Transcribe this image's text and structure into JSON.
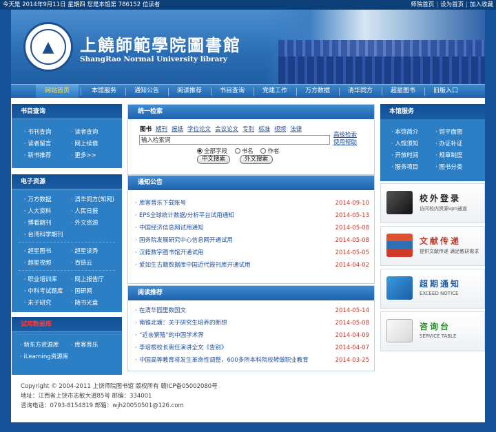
{
  "topbar": {
    "left_text": "今天是 2014年9月11日 星期四 您是本馆第 786152 位读者",
    "links": [
      "师院首页",
      "设为首页",
      "加入收藏"
    ]
  },
  "banner": {
    "title_cn": "上饒師範學院圖書館",
    "title_en": "ShangRao Normal University library"
  },
  "nav": [
    "网站首页",
    "本馆服务",
    "通知公告",
    "阅读推荐",
    "书目查询",
    "党建工作",
    "万方数据",
    "清华同方",
    "超星图书",
    "旧版入口"
  ],
  "left": {
    "catalog": {
      "title": "书目查询",
      "links": [
        "书刊查询",
        "读者查询",
        "读者留言",
        "网上续借",
        "新书推荐",
        "更多>>"
      ]
    },
    "eres": {
      "title": "电子资源",
      "links": [
        "万方数据",
        "清华同方(知网)",
        "人大资料",
        "人民日报",
        "博看期刊",
        "外文资源",
        "台湾科学期刊",
        "超星图书",
        "超星读秀",
        "超星视频",
        "百链云",
        "职业培训库",
        "网上报告厅",
        "中科考试题库",
        "国研网",
        "未子研究",
        "随书光盘"
      ]
    },
    "trial": {
      "title": "试用数据库",
      "links": [
        "新东方资源库",
        "库客音乐",
        "iLearning资源库"
      ]
    }
  },
  "search": {
    "title": "统一检索",
    "categories": [
      "图书",
      "期刊",
      "报纸",
      "学位论文",
      "会议论文",
      "专利",
      "标准",
      "视频",
      "法律"
    ],
    "input_value": "输入检索词",
    "advanced": "高级检索",
    "help": "使用帮助",
    "radios": [
      "全部字段",
      "书名",
      "作者"
    ],
    "btn_cn": "中文搜索",
    "btn_en": "外文搜索"
  },
  "notices": {
    "title": "通知公告",
    "items": [
      {
        "t": "库客音乐下载账号",
        "d": "2014-09-10"
      },
      {
        "t": "EPS全球统计数据/分析平台试用通知",
        "d": "2014-05-13"
      },
      {
        "t": "中国经济信息网试用通知",
        "d": "2014-05-08"
      },
      {
        "t": "国务院发展研究中心信息网开通试用",
        "d": "2014-05-08"
      },
      {
        "t": "汉籍数字图书馆开通试用",
        "d": "2014-05-05"
      },
      {
        "t": "爱如生古籍数据库中国近代报刊库开通试用",
        "d": "2014-04-02"
      }
    ]
  },
  "reading": {
    "title": "阅读推荐",
    "items": [
      {
        "t": "在清华园里数国文",
        "d": "2014-05-14"
      },
      {
        "t": "南锥北塘：关于研究生培养的断想",
        "d": "2014-05-08"
      },
      {
        "t": "“近亲繁殖”的中国学术界",
        "d": "2014-04-09"
      },
      {
        "t": "李培根校长离任演讲全文《告别》",
        "d": "2014-04-07"
      },
      {
        "t": "中国高等教育将发生革命性调整，600多所本科院校转做职业教育",
        "d": "2014-03-25"
      }
    ]
  },
  "services": {
    "title": "本馆服务",
    "links": [
      "本馆简介",
      "馆平面图",
      "入馆须知",
      "办证补证",
      "开放时间",
      "规章制度",
      "服务项目",
      "图书分类"
    ]
  },
  "cards": [
    {
      "title": "校外登录",
      "sub": "访问校内资源vpn通道",
      "color": "#222222",
      "icon": "login-icon"
    },
    {
      "title": "文献传递",
      "sub": "提供文献传递 满足教研需求",
      "color": "#c0392b",
      "icon": "books-icon"
    },
    {
      "title": "超期通知",
      "sub": "EXCEED NOTICE",
      "color": "#1f5ea3",
      "icon": "notice-icon"
    },
    {
      "title": "咨询台",
      "sub": "SERVICE TABLE",
      "color": "#2e8b2e",
      "icon": "mail-icon"
    }
  ],
  "footer": {
    "line1": "Copyright © 2004-2011 上饶师院图书馆 版权所有 赣ICP备05002080号",
    "line2": "地址：江西省上饶市志敏大道85号 邮编：334001",
    "line3": "咨询电话：0793-8154819 邮箱：wjh20050501@126.com"
  }
}
